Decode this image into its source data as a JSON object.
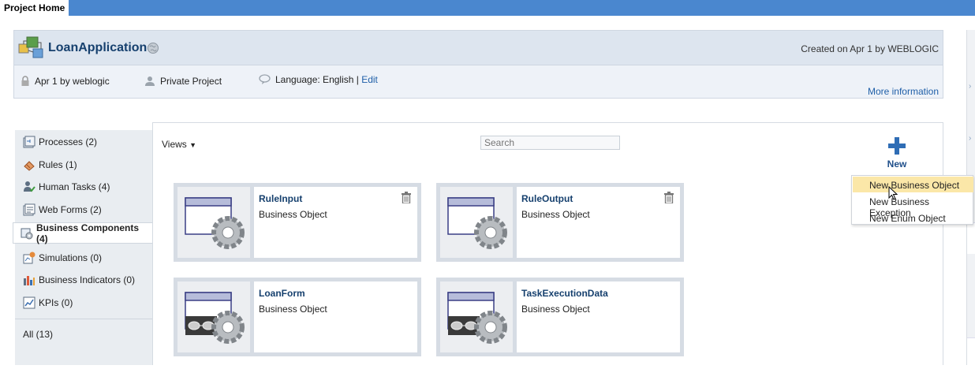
{
  "tabs": {
    "home": "Project Home"
  },
  "project": {
    "title": "LoanApplication",
    "created": "Created on Apr 1 by WEBLOGIC",
    "lock_text": "Apr 1 by weblogic",
    "privacy": "Private Project",
    "language": "Language: English | ",
    "edit": "Edit",
    "more_info": "More information"
  },
  "sidebar": {
    "items": [
      {
        "label": "Processes (2)",
        "icon": "processes-icon"
      },
      {
        "label": "Rules (1)",
        "icon": "rules-icon"
      },
      {
        "label": "Human Tasks (4)",
        "icon": "human-tasks-icon"
      },
      {
        "label": "Web Forms (2)",
        "icon": "web-forms-icon"
      },
      {
        "label": "Business Components (4)",
        "icon": "business-components-icon"
      },
      {
        "label": "Simulations (0)",
        "icon": "simulations-icon"
      },
      {
        "label": "Business Indicators (0)",
        "icon": "business-indicators-icon"
      },
      {
        "label": "KPIs (0)",
        "icon": "kpis-icon"
      }
    ],
    "all": "All (13)"
  },
  "toolbar": {
    "views": "Views",
    "search_placeholder": "Search",
    "new": "New"
  },
  "cards": [
    {
      "title": "RuleInput",
      "subtitle": "Business Object"
    },
    {
      "title": "RuleOutput",
      "subtitle": "Business Object"
    },
    {
      "title": "LoanForm",
      "subtitle": "Business Object"
    },
    {
      "title": "TaskExecutionData",
      "subtitle": "Business Object"
    }
  ],
  "new_menu": {
    "items": [
      "New Business Object",
      "New Business Exception",
      "New Enum Object"
    ]
  },
  "colors": {
    "top_bar": "#4a87cf",
    "link": "#1f5fa8",
    "title": "#16406e",
    "menu_hover": "#fbe7a8"
  }
}
